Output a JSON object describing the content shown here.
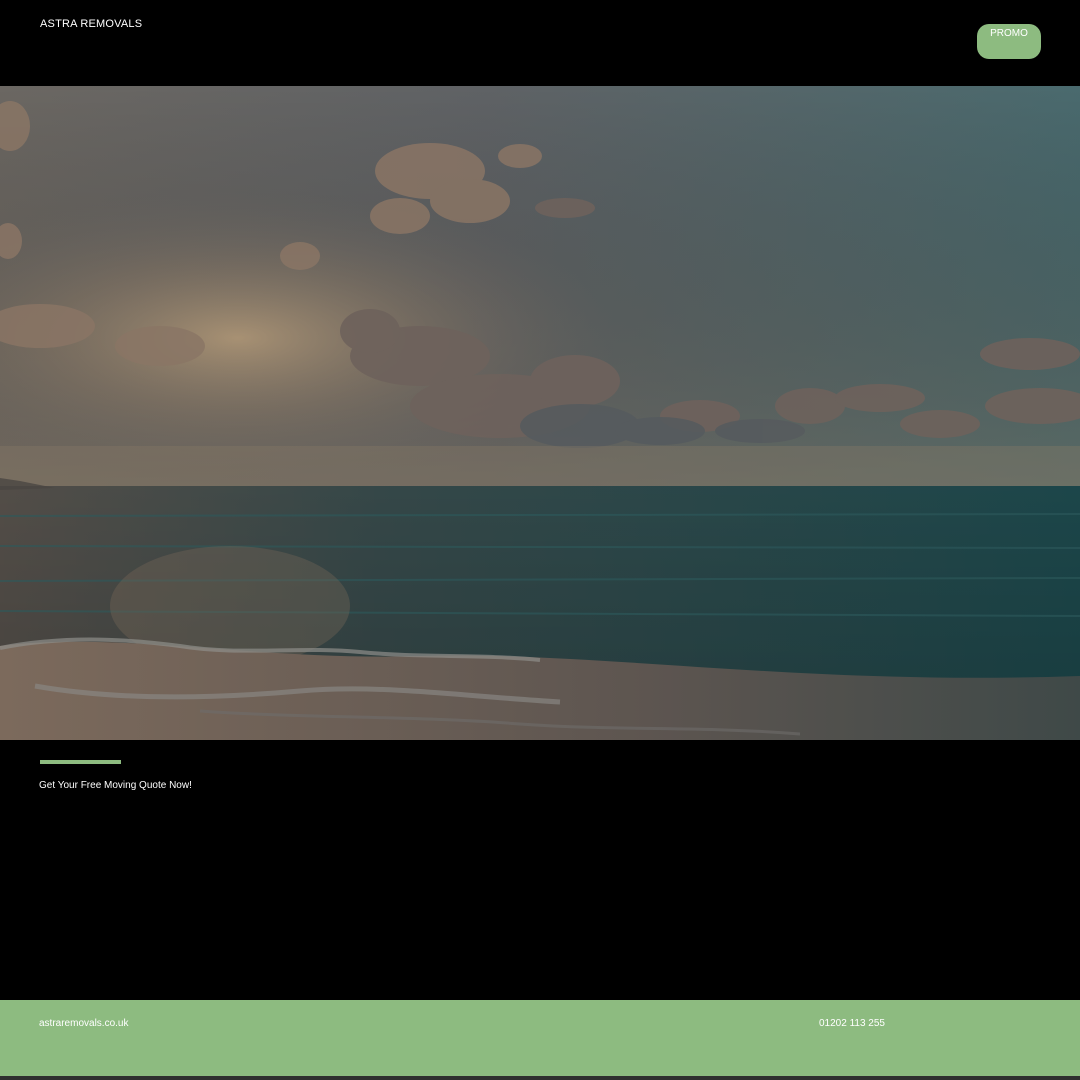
{
  "header": {
    "brand": "ASTRA REMOVALS",
    "promo_label": "PROMO"
  },
  "hero": {
    "image": "sunset-ocean-beach-image"
  },
  "cta": {
    "text": "Get Your Free Moving Quote Now!"
  },
  "footer": {
    "website": "astraremovals.co.uk",
    "phone": "01202 113 255"
  },
  "colors": {
    "accent": "#8dbb80",
    "background": "#000000",
    "text": "#ffffff"
  }
}
